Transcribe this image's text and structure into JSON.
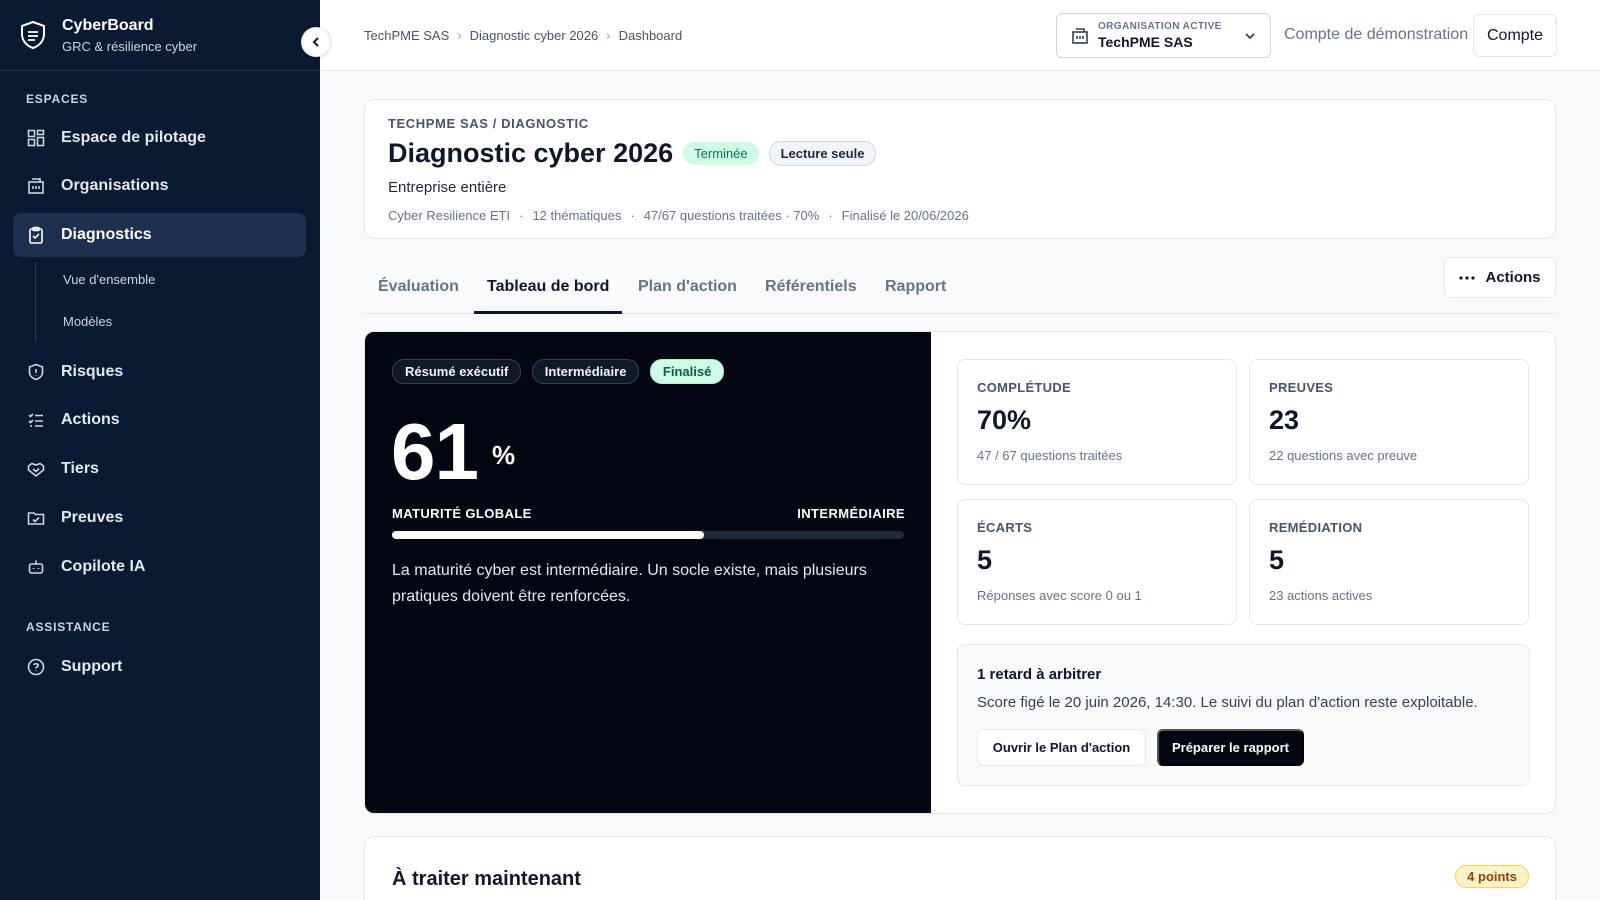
{
  "brand": {
    "name": "CyberBoard",
    "subtitle": "GRC & résilience cyber"
  },
  "sidebar": {
    "section_spaces": "ESPACES",
    "items": [
      {
        "label": "Espace de pilotage",
        "icon": "dashboard-icon"
      },
      {
        "label": "Organisations",
        "icon": "building-icon"
      },
      {
        "label": "Diagnostics",
        "icon": "clipboard-icon",
        "active": true
      },
      {
        "label": "Risques",
        "icon": "shield-icon"
      },
      {
        "label": "Actions",
        "icon": "checklist-icon"
      },
      {
        "label": "Tiers",
        "icon": "handshake-icon"
      },
      {
        "label": "Preuves",
        "icon": "folder-check-icon"
      },
      {
        "label": "Copilote IA",
        "icon": "bot-icon"
      }
    ],
    "sub_items": [
      "Vue d'ensemble",
      "Modèles"
    ],
    "section_assistance": "ASSISTANCE",
    "support": {
      "label": "Support",
      "icon": "help-circle-icon"
    }
  },
  "topbar": {
    "breadcrumb": [
      "TechPME SAS",
      "Diagnostic cyber 2026",
      "Dashboard"
    ],
    "org_kicker": "ORGANISATION ACTIVE",
    "org_name": "TechPME SAS",
    "demo_label": "Compte de démonstration",
    "account_button": "Compte"
  },
  "header": {
    "kicker": "TECHPME SAS / DIAGNOSTIC",
    "title": "Diagnostic cyber 2026",
    "status_badge": "Terminée",
    "readonly_badge": "Lecture seule",
    "scope": "Entreprise entière",
    "meta": [
      "Cyber Resilience ETI",
      "12 thématiques",
      "47/67 questions traitées · 70%",
      "Finalisé le 20/06/2026"
    ]
  },
  "tabs": [
    "Évaluation",
    "Tableau de bord",
    "Plan d'action",
    "Référentiels",
    "Rapport"
  ],
  "active_tab": "Tableau de bord",
  "actions_button": "Actions",
  "executive": {
    "chips": [
      "Résumé exécutif",
      "Intermédiaire",
      "Finalisé"
    ],
    "score": "61",
    "unit": "%",
    "score_value": 61,
    "maturity_label": "MATURITÉ GLOBALE",
    "maturity_level": "INTERMÉDIAIRE",
    "summary": "La maturité cyber est intermédiaire. Un socle existe, mais plusieurs pratiques doivent être renforcées."
  },
  "kpis": [
    {
      "label": "COMPLÉTUDE",
      "value": "70%",
      "sub": "47 / 67 questions traitées"
    },
    {
      "label": "PREUVES",
      "value": "23",
      "sub": "22 questions avec preuve"
    },
    {
      "label": "ÉCARTS",
      "value": "5",
      "sub": "Réponses avec score 0 ou 1"
    },
    {
      "label": "REMÉDIATION",
      "value": "5",
      "sub": "23 actions actives"
    }
  ],
  "retard": {
    "title": "1 retard à arbitrer",
    "text": "Score figé le 20 juin 2026, 14:30. Le suivi du plan d'action reste exploitable.",
    "open_button": "Ouvrir le Plan d'action",
    "report_button": "Préparer le rapport"
  },
  "todo": {
    "title": "À traiter maintenant",
    "badge": "4 points"
  }
}
